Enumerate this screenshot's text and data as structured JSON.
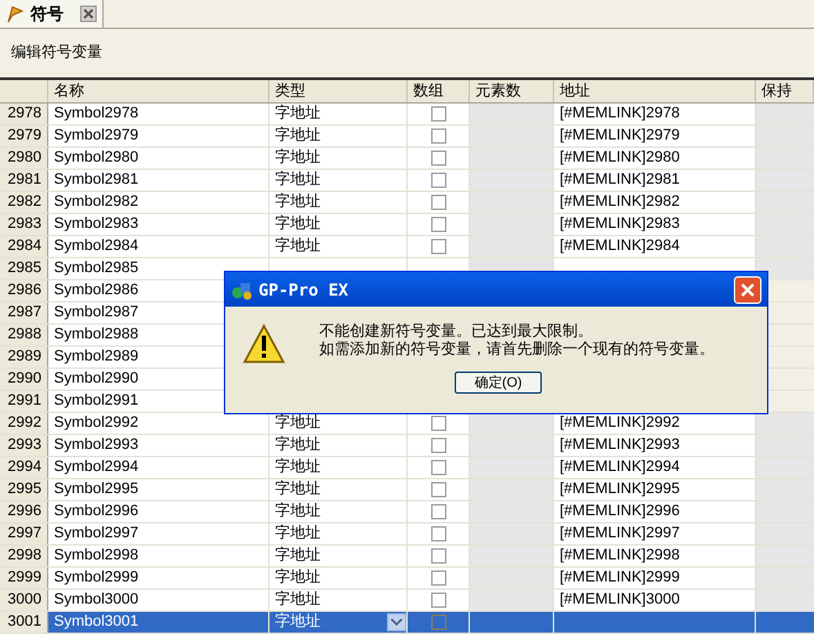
{
  "tab": {
    "label": "符号",
    "selected": true
  },
  "heading": "编辑符号变量",
  "table": {
    "columns": [
      "名称",
      "类型",
      "数组",
      "元素数",
      "地址",
      "保持"
    ],
    "rows": [
      {
        "num": "2978",
        "name": "Symbol2978",
        "type": "字地址",
        "array": false,
        "address": "[#MEMLINK]2978",
        "selected": false
      },
      {
        "num": "2979",
        "name": "Symbol2979",
        "type": "字地址",
        "array": false,
        "address": "[#MEMLINK]2979",
        "selected": false
      },
      {
        "num": "2980",
        "name": "Symbol2980",
        "type": "字地址",
        "array": false,
        "address": "[#MEMLINK]2980",
        "selected": false
      },
      {
        "num": "2981",
        "name": "Symbol2981",
        "type": "字地址",
        "array": false,
        "address": "[#MEMLINK]2981",
        "selected": false
      },
      {
        "num": "2982",
        "name": "Symbol2982",
        "type": "字地址",
        "array": false,
        "address": "[#MEMLINK]2982",
        "selected": false
      },
      {
        "num": "2983",
        "name": "Symbol2983",
        "type": "字地址",
        "array": false,
        "address": "[#MEMLINK]2983",
        "selected": false
      },
      {
        "num": "2984",
        "name": "Symbol2984",
        "type": "字地址",
        "array": false,
        "address": "[#MEMLINK]2984",
        "selected": false
      },
      {
        "num": "2985",
        "name": "Symbol2985",
        "selected": false
      },
      {
        "num": "2986",
        "name": "Symbol2986",
        "selected": false
      },
      {
        "num": "2987",
        "name": "Symbol2987",
        "selected": false
      },
      {
        "num": "2988",
        "name": "Symbol2988",
        "selected": false
      },
      {
        "num": "2989",
        "name": "Symbol2989",
        "selected": false
      },
      {
        "num": "2990",
        "name": "Symbol2990",
        "selected": false
      },
      {
        "num": "2991",
        "name": "Symbol2991",
        "selected": false
      },
      {
        "num": "2992",
        "name": "Symbol2992",
        "type": "字地址",
        "array": false,
        "address": "[#MEMLINK]2992",
        "selected": false
      },
      {
        "num": "2993",
        "name": "Symbol2993",
        "type": "字地址",
        "array": false,
        "address": "[#MEMLINK]2993",
        "selected": false
      },
      {
        "num": "2994",
        "name": "Symbol2994",
        "type": "字地址",
        "array": false,
        "address": "[#MEMLINK]2994",
        "selected": false
      },
      {
        "num": "2995",
        "name": "Symbol2995",
        "type": "字地址",
        "array": false,
        "address": "[#MEMLINK]2995",
        "selected": false
      },
      {
        "num": "2996",
        "name": "Symbol2996",
        "type": "字地址",
        "array": false,
        "address": "[#MEMLINK]2996",
        "selected": false
      },
      {
        "num": "2997",
        "name": "Symbol2997",
        "type": "字地址",
        "array": false,
        "address": "[#MEMLINK]2997",
        "selected": false
      },
      {
        "num": "2998",
        "name": "Symbol2998",
        "type": "字地址",
        "array": false,
        "address": "[#MEMLINK]2998",
        "selected": false
      },
      {
        "num": "2999",
        "name": "Symbol2999",
        "type": "字地址",
        "array": false,
        "address": "[#MEMLINK]2999",
        "selected": false
      },
      {
        "num": "3000",
        "name": "Symbol3000",
        "type": "字地址",
        "array": false,
        "address": "[#MEMLINK]3000",
        "selected": false
      },
      {
        "num": "3001",
        "name": "Symbol3001",
        "type": "字地址",
        "array": false,
        "selected": true
      }
    ]
  },
  "dialog": {
    "title": "GP-Pro EX",
    "message_lines": [
      "不能创建新符号变量。已达到最大限制。",
      "如需添加新的符号变量，请首先删除一个现有的符号变量。"
    ],
    "button": "确定(O)"
  }
}
